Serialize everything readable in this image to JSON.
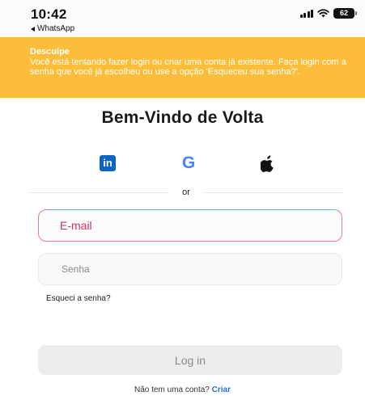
{
  "status_bar": {
    "time": "10:42",
    "back_app": "WhatsApp",
    "battery": "62",
    "icons": [
      "signal-icon",
      "wifi-icon",
      "battery-icon"
    ]
  },
  "banner": {
    "title": "Desculpe",
    "message": "Você está tentando fazer login ou criar uma conta já existente. Faça login com a senha que você já escolheu ou use a opção 'Esqueceu sua senha?'.",
    "background_color": "#fbbd3a"
  },
  "heading": "Bem-Vindo de Volta",
  "social": {
    "linkedin_label": "in",
    "google_label": "G",
    "apple_glyph": "",
    "icons": [
      "linkedin-icon",
      "google-icon",
      "apple-icon"
    ]
  },
  "divider_text": "or",
  "form": {
    "email_placeholder": "E-mail",
    "password_placeholder": "Senha",
    "forgot_password": "Esqueci a senha?",
    "login_button": "Log in"
  },
  "signup": {
    "prompt": "Não tem uma conta?",
    "link": "Criar"
  },
  "colors": {
    "email_border_error": "#e07d96",
    "link": "#2a6fd6",
    "linkedin": "#0a66c2"
  }
}
